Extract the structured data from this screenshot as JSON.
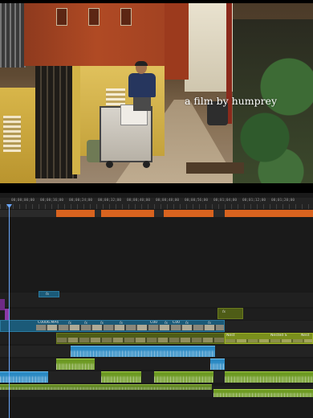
{
  "monitor": {
    "caption": "a film by humprey"
  },
  "timeline": {
    "timecodes": [
      "00;00;00;00",
      "00;00;16;00",
      "00;00;24;00",
      "00;00;32;00",
      "00;00;40;00",
      "00;00;48;00",
      "00;00;56;00",
      "00;01;04;00",
      "00;01;12;00",
      "00;01;20;00"
    ],
    "clips": {
      "c0006": "C0006.MP4",
      "nested1": "Nest",
      "nested2": "Nested S",
      "nested3": "Nest",
      "c00": "C00",
      "fx": "fx"
    },
    "colors": {
      "render_orange": "#d8631f",
      "render_dark": "#2a2a2a",
      "playhead": "#6aa8ff",
      "video_teal": "#1b5a78",
      "video_olive": "#7a8f1c",
      "audio_blue": "#2b8ac4",
      "audio_green": "#6d9a23",
      "marker_purple": "#6e2a86"
    }
  }
}
